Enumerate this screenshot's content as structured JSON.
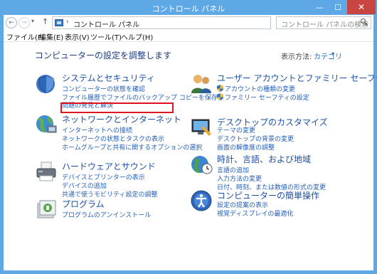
{
  "window": {
    "title": "コントロール パネル",
    "min_glyph": "—",
    "max_glyph": "☐",
    "close_glyph": "✕",
    "frame_color": "#5ea8e6",
    "close_color": "#c84541"
  },
  "nav": {
    "back_glyph": "←",
    "forward_glyph": "→",
    "dropdown_glyph": "▾",
    "up_glyph": "↑",
    "address_separator": "›",
    "address_text": "コントロール パネル",
    "address_dropdown_glyph": "▾",
    "refresh_glyph": "↻",
    "search_placeholder": "コントロール パネルの検索"
  },
  "menu": {
    "items": [
      "ファイル(F)",
      "編集(E)",
      "表示(V)",
      "ツール(T)",
      "ヘルプ(H)"
    ]
  },
  "main": {
    "title": "コンピューターの設定を調整します",
    "view_by_label": "表示方法:",
    "view_by_value": "カテゴリ",
    "view_by_caret": "▾"
  },
  "categories": {
    "security": {
      "title": "システムとセキュリティ",
      "links": [
        "コンピューターの状態を確認",
        "ファイル履歴でファイルのバックアップ コピーを保存",
        "問題の発見と解決"
      ]
    },
    "network": {
      "title": "ネットワークとインターネット",
      "links": [
        "インターネットへの接続",
        "ネットワークの状態とタスクの表示",
        "ホームグループと共有に関するオプションの選択"
      ]
    },
    "hardware": {
      "title": "ハードウェアとサウンド",
      "links": [
        "デバイスとプリンターの表示",
        "デバイスの追加",
        "共通で使うモビリティ設定の調整"
      ]
    },
    "programs": {
      "title": "プログラム",
      "links": [
        "プログラムのアンインストール"
      ]
    },
    "accounts": {
      "title": "ユーザー アカウントとファミリー セーフティ",
      "links": [
        "アカウントの種類の変更",
        "ファミリー セーフティの設定"
      ]
    },
    "appearance": {
      "title": "デスクトップのカスタマイズ",
      "links": [
        "テーマの変更",
        "デスクトップの背景の変更",
        "画面の解像度の調整"
      ]
    },
    "clock": {
      "title": "時計、言語、および地域",
      "links": [
        "言語の追加",
        "入力方法の変更",
        "日付、時刻、または数値の形式の変更"
      ]
    },
    "ease": {
      "title": "コンピューターの簡単操作",
      "links": [
        "設定の提案の表示",
        "視覚ディスプレイの最適化"
      ]
    }
  },
  "highlight_color": "#e0141e",
  "link_color": "#1f5dbd"
}
